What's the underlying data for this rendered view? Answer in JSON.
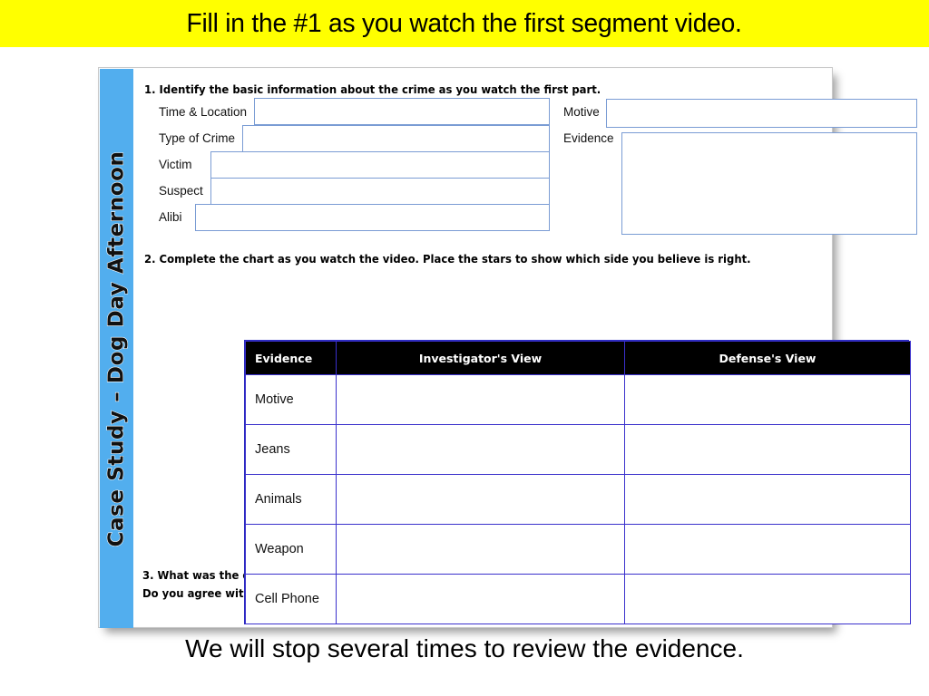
{
  "banner": {
    "text": "Fill in the #1 as you watch the first segment video."
  },
  "caption": {
    "text": "We will stop several times to review the evidence."
  },
  "worksheet": {
    "spine_title": "Case Study – Dog Day Afternoon",
    "spine_color": "#52AEEE",
    "section1": {
      "prompt": "1. Identify the basic information about the crime as you watch the first part.",
      "left_fields": [
        {
          "label": "Time & Location",
          "value": ""
        },
        {
          "label": "Type of Crime",
          "value": ""
        },
        {
          "label": "Victim",
          "value": ""
        },
        {
          "label": "Suspect",
          "value": ""
        },
        {
          "label": "Alibi",
          "value": ""
        }
      ],
      "right_fields": [
        {
          "label": "Motive",
          "value": ""
        },
        {
          "label": "Evidence",
          "value": ""
        }
      ]
    },
    "section2": {
      "prompt": "2. Complete the chart as you watch the video.  Place the stars to show which side you believe is right.",
      "headers": [
        "Evidence",
        "Investigator's View",
        "Defense's View"
      ],
      "rows": [
        {
          "evidence": "Motive",
          "investigator": "",
          "defense": ""
        },
        {
          "evidence": "Jeans",
          "investigator": "",
          "defense": ""
        },
        {
          "evidence": "Animals",
          "investigator": "",
          "defense": ""
        },
        {
          "evidence": "Weapon",
          "investigator": "",
          "defense": ""
        },
        {
          "evidence": "Cell Phone",
          "investigator": "",
          "defense": ""
        }
      ],
      "header_bg": "#000000",
      "border_color": "#3a30cc"
    },
    "section3": {
      "prompt_line1": "3. What was the outcome of the case?",
      "prompt_line2": "Do you agree with the jury's verdict?",
      "answer": ""
    }
  }
}
